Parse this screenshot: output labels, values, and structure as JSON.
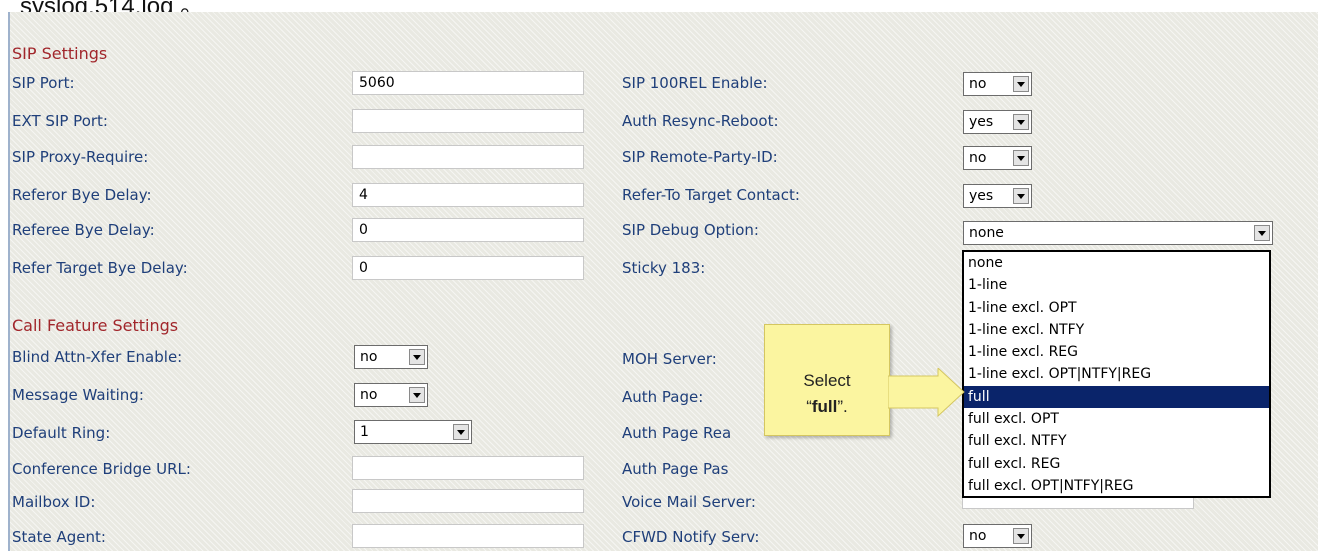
{
  "top_text": "syslog.514.log 。",
  "sip_settings": {
    "title": "SIP Settings",
    "left": [
      {
        "label": "SIP Port:",
        "value": "5060"
      },
      {
        "label": "EXT SIP Port:",
        "value": ""
      },
      {
        "label": "SIP Proxy-Require:",
        "value": ""
      },
      {
        "label": "Referor Bye Delay:",
        "value": "4"
      },
      {
        "label": "Referee Bye Delay:",
        "value": "0"
      },
      {
        "label": "Refer Target Bye Delay:",
        "value": "0"
      }
    ],
    "right": [
      {
        "label": "SIP 100REL Enable:",
        "value": "no"
      },
      {
        "label": "Auth Resync-Reboot:",
        "value": "yes"
      },
      {
        "label": "SIP Remote-Party-ID:",
        "value": "no"
      },
      {
        "label": "Refer-To Target Contact:",
        "value": "yes"
      },
      {
        "label": "SIP Debug Option:",
        "value": "none"
      },
      {
        "label": "Sticky 183:",
        "value": ""
      }
    ]
  },
  "call_feature_settings": {
    "title": "Call Feature Settings",
    "left": [
      {
        "label": "Blind Attn-Xfer Enable:",
        "value": "no"
      },
      {
        "label": "Message Waiting:",
        "value": "no"
      },
      {
        "label": "Default Ring:",
        "value": "1"
      },
      {
        "label": "Conference Bridge URL:",
        "value": ""
      },
      {
        "label": "Mailbox ID:",
        "value": ""
      },
      {
        "label": "State Agent:",
        "value": ""
      }
    ],
    "right": [
      {
        "label": "MOH Server:",
        "value": ""
      },
      {
        "label": "Auth Page:",
        "value": ""
      },
      {
        "label": "Auth Page Rea",
        "value": ""
      },
      {
        "label": "Auth Page Pas",
        "value": ""
      },
      {
        "label": "Voice Mail Server:",
        "value": ""
      },
      {
        "label": "CFWD Notify Serv:",
        "value": "no"
      }
    ]
  },
  "debug_dropdown_options": [
    "none",
    "1-line",
    "1-line excl. OPT",
    "1-line excl. NTFY",
    "1-line excl. REG",
    "1-line excl. OPT|NTFY|REG",
    "full",
    "full excl. OPT",
    "full excl. NTFY",
    "full excl. REG",
    "full excl. OPT|NTFY|REG"
  ],
  "debug_dropdown_selected_index": 6,
  "callout": {
    "line1": "Select",
    "quote_open": "“",
    "bold": "full",
    "quote_close": "”."
  },
  "colors": {
    "section_title": "#a1262b",
    "label": "#1f3f7a",
    "selection": "#0a246a",
    "callout_bg": "#fbf5a0"
  }
}
